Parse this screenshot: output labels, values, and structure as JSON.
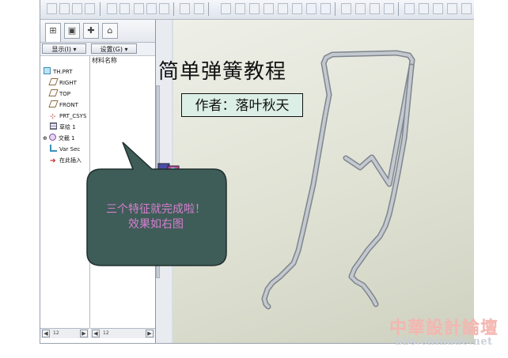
{
  "navigator": {
    "show_menu": "显示(I) ▾",
    "settings_menu": "设置(G) ▾",
    "column_header": "材料名称",
    "tree_items": [
      {
        "label": "TH.PRT",
        "icon": "part-icon"
      },
      {
        "label": "RIGHT",
        "icon": "datum-plane-icon"
      },
      {
        "label": "TOP",
        "icon": "datum-plane-icon"
      },
      {
        "label": "FRONT",
        "icon": "datum-plane-icon"
      },
      {
        "label": "PRT_CSYS",
        "icon": "coordinate-system-icon"
      },
      {
        "label": "草绘 1",
        "icon": "sketch-icon"
      },
      {
        "label": "交截 1",
        "icon": "intersect-icon"
      },
      {
        "label": "Var Sec",
        "icon": "sweep-icon"
      },
      {
        "label": "在此插入",
        "icon": "insert-here-icon"
      }
    ],
    "scroll_label_left": "12",
    "scroll_label_right": "12"
  },
  "slide": {
    "title": "简单弹簧教程",
    "author": "作者：落叶秋天",
    "callout_line1": "三个特征就完成啦！",
    "callout_line2": "效果如右图"
  },
  "watermark": {
    "line1": "中華設計論壇",
    "line2": "bbs.chinade.net"
  },
  "colors": {
    "callout_fill": "#3f5d58",
    "callout_text": "#d67fd0",
    "author_box": "#dcefe6",
    "spring_wire": "#b7bcc4"
  }
}
